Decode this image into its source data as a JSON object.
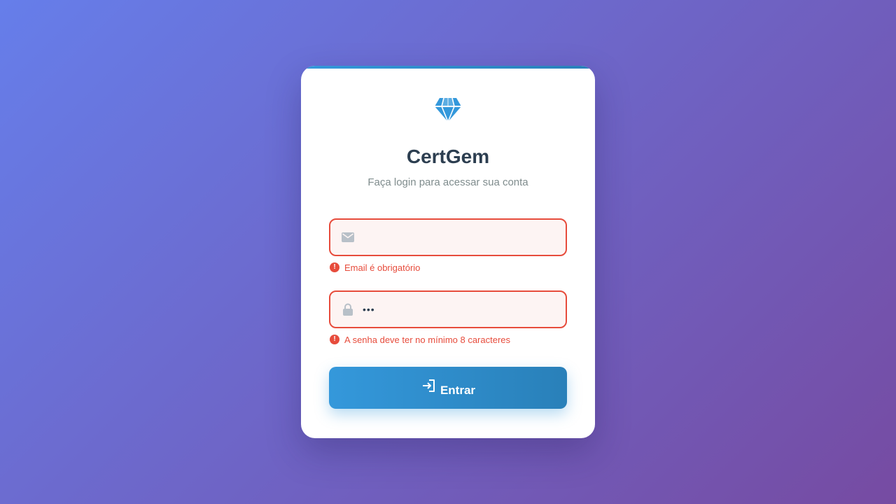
{
  "brand": {
    "name": "CertGem",
    "subtitle": "Faça login para acessar sua conta",
    "logo_icon": "gem-icon",
    "accent_color": "#3498db"
  },
  "form": {
    "email": {
      "icon": "envelope-icon",
      "value": "",
      "type": "email",
      "error": "Email é obrigatório"
    },
    "password": {
      "icon": "lock-icon",
      "value": "•••",
      "type": "password",
      "error": "A senha deve ter no mínimo 8 caracteres"
    },
    "submit": {
      "icon": "sign-in-icon",
      "label": "Entrar"
    },
    "error_color": "#e74c3c"
  }
}
